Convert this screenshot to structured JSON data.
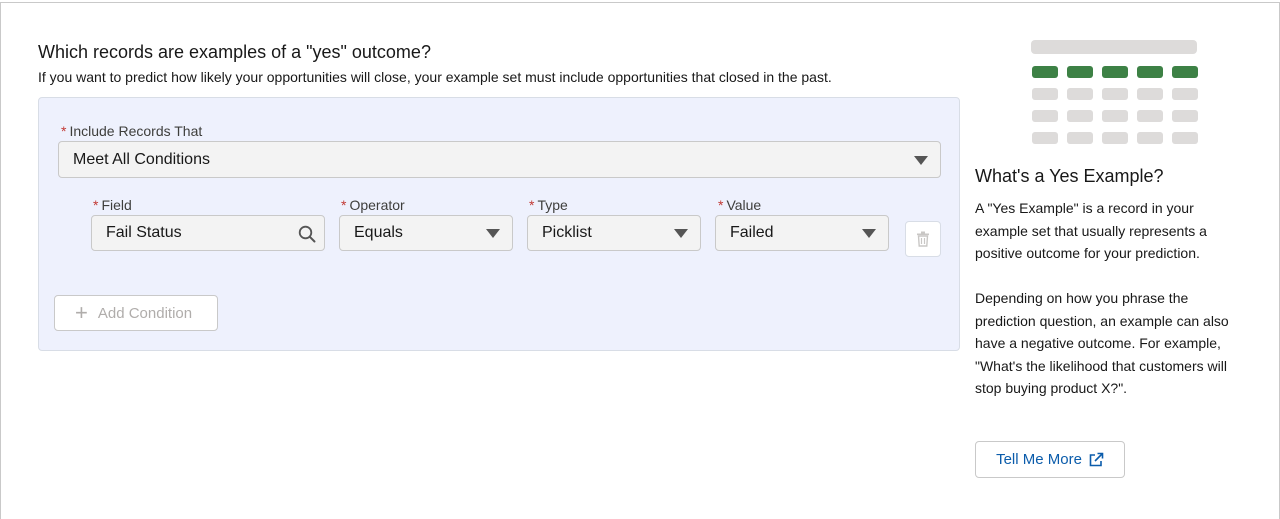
{
  "main": {
    "heading": "Which records are examples of a \"yes\" outcome?",
    "subheading": "If you want to predict how likely your opportunities will close, your example set must include opportunities that closed in the past."
  },
  "filter": {
    "required_marker": "*",
    "include_label": "Include Records That",
    "include_value": "Meet All Conditions",
    "condition": {
      "field_label": "Field",
      "field_value": "Fail Status",
      "operator_label": "Operator",
      "operator_value": "Equals",
      "type_label": "Type",
      "type_value": "Picklist",
      "value_label": "Value",
      "value_value": "Failed"
    },
    "add_condition_label": "Add Condition"
  },
  "sidebar": {
    "title": "What's a Yes Example?",
    "paragraph1": "A \"Yes Example\" is a record in your example set that usually represents a positive outcome for your prediction.",
    "paragraph2": "Depending on how you phrase the prediction question, an example can also have a negative outcome. For example, \"What's the likelihood that customers will stop buying product X?\".",
    "button_label": "Tell Me More"
  },
  "icons": {
    "field_search": "search-icon",
    "delete": "trash-icon",
    "add": "plus-icon",
    "external": "external-link-icon",
    "illustration": "table-illustration"
  },
  "colors": {
    "panel_bg": "#eef1fd",
    "required": "#c23934",
    "link": "#0b5cab",
    "illustration_highlight": "#3d8145",
    "illustration_gray": "#dddbda"
  }
}
